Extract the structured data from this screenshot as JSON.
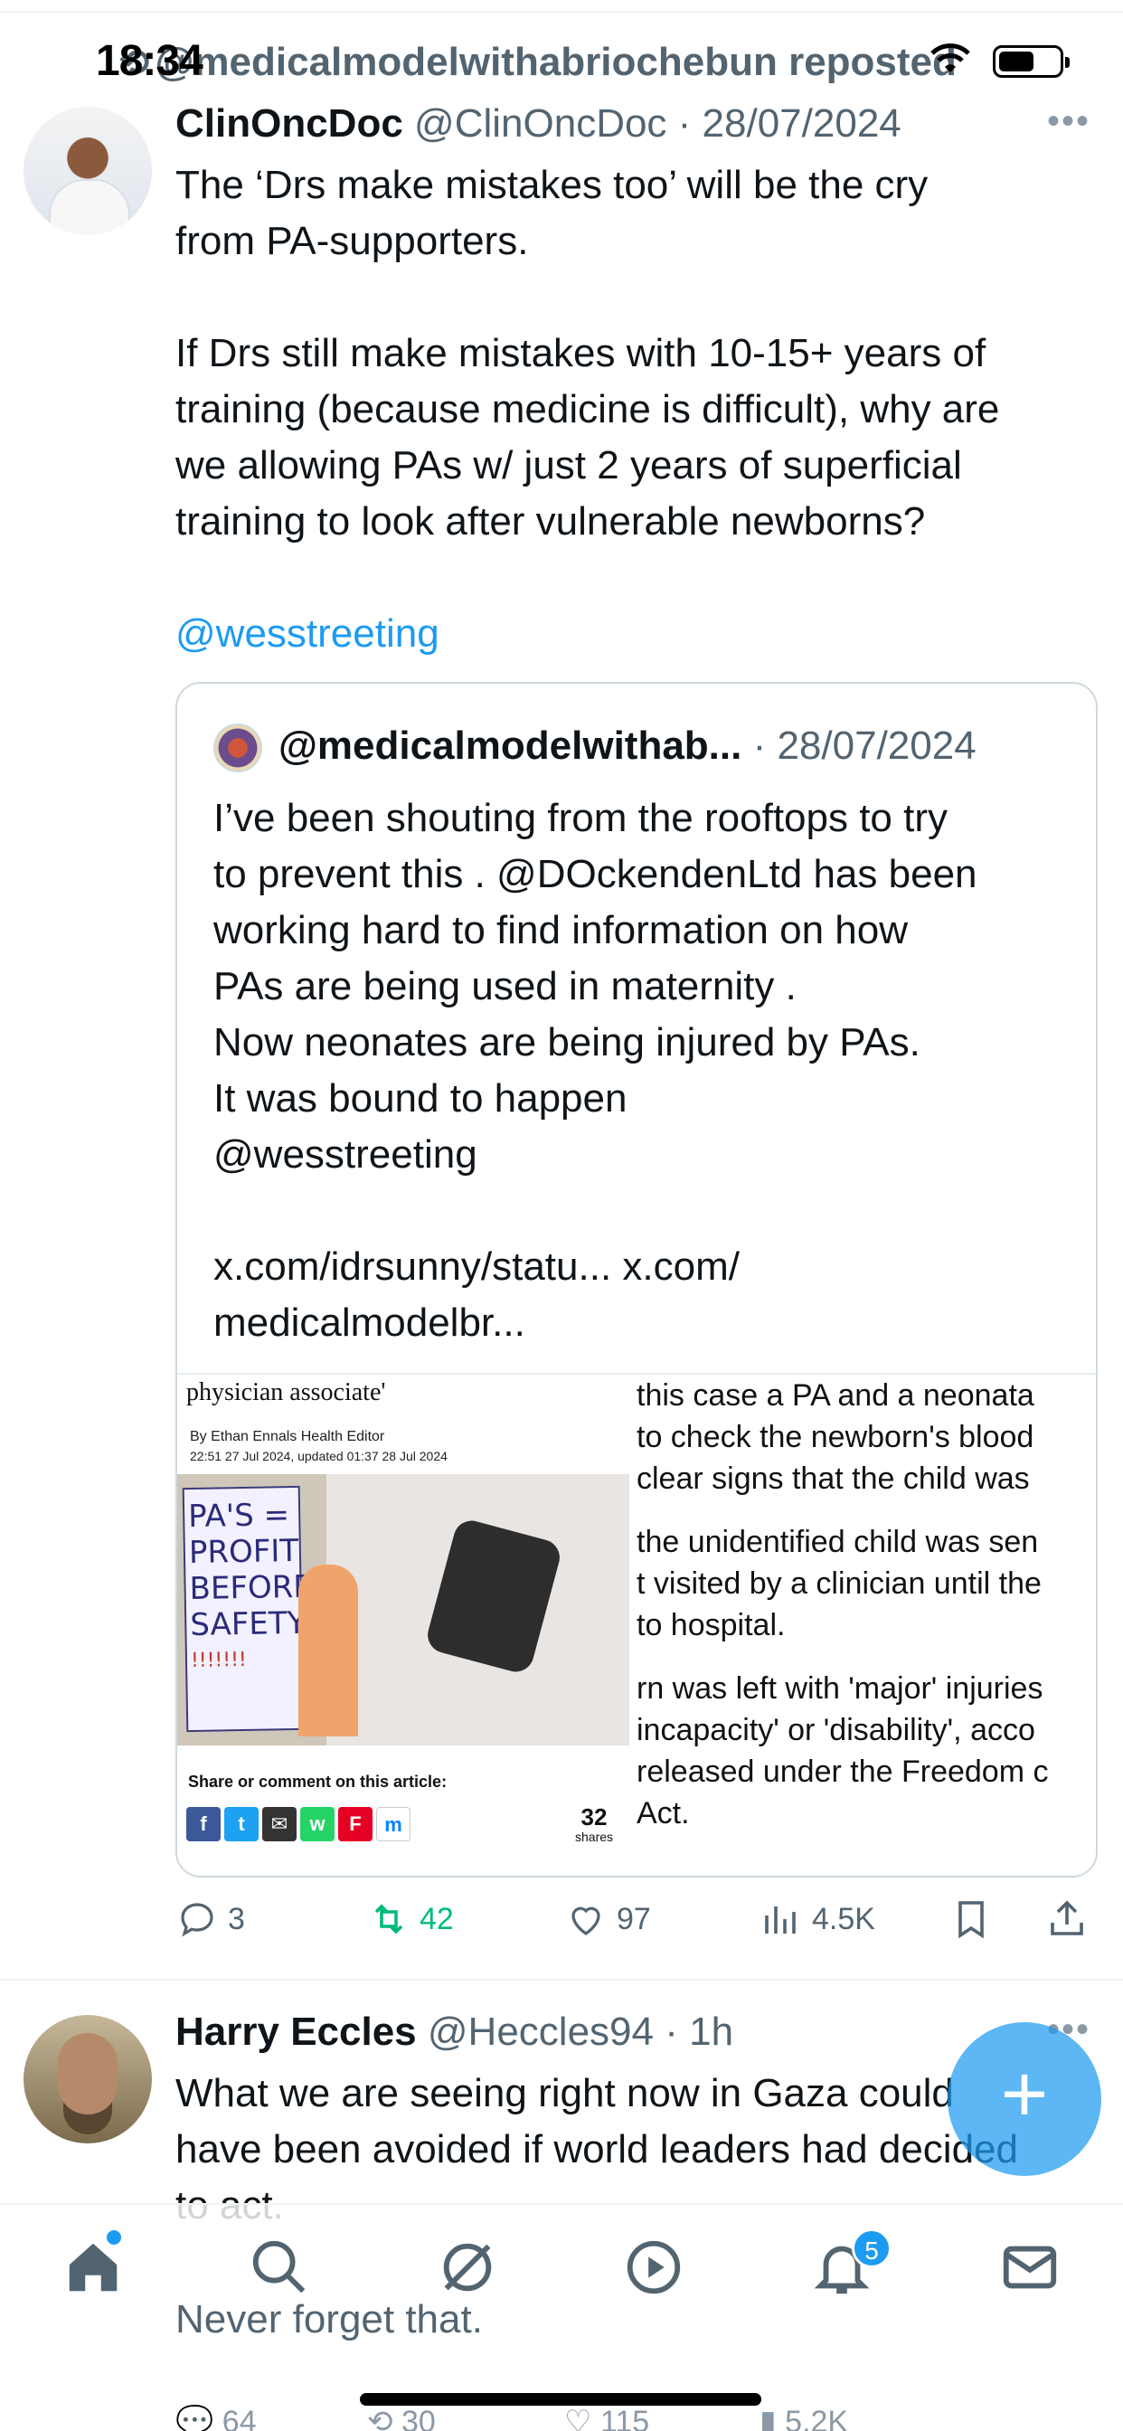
{
  "status_bar": {
    "time": "18:34",
    "repost_text": "@medicalmodelwithabriochebun reposted"
  },
  "tweet1": {
    "author_name": "ClinOncDoc",
    "handle": "@ClinOncDoc",
    "date": "· 28/07/2024",
    "lines": [
      "The ‘Drs make mistakes too’ will be the cry",
      "from PA-supporters.",
      "",
      "If Drs still make mistakes with 10-15+ years of",
      "training (because medicine is difficult), why are",
      "we allowing PAs w/ just 2 years of superficial",
      "training to look after vulnerable newborns?"
    ],
    "mention": "@wesstreeting",
    "quote": {
      "handle": "@medicalmodelwithab...",
      "date": "· 28/07/2024",
      "lines": [
        "I’ve been shouting from the rooftops to try",
        "to prevent  this . @DOckendenLtd has been",
        "working hard to find information on how",
        "PAs are being used in maternity .",
        "Now neonates  are being injured by PAs.",
        "It was bound to happen",
        "@wesstreeting",
        "",
        "x.com/idrsunny/statu... x.com/",
        "medicalmodelbr..."
      ],
      "article": {
        "headline": "physician associate'",
        "byline": "By Ethan Ennals Health Editor",
        "timestamp": "22:51 27 Jul 2024, updated 01:37 28 Jul 2024",
        "sign_text": [
          "PA'S =",
          "PROFIT",
          "BEFORE",
          "SAFETY",
          "!!!!!!!"
        ],
        "share_label": "Share or comment on this article:",
        "share_count": "32",
        "share_unit": "shares",
        "right_lines": [
          "this case a PA and a neonata",
          "to check the newborn's blood",
          "clear signs that the child was",
          "",
          "the unidentified child was sen",
          "t visited by a clinician until the",
          "to hospital.",
          "",
          "rn was left with 'major' injuries",
          "incapacity' or 'disability', acco",
          "released under the Freedom c",
          "Act."
        ]
      }
    },
    "actions": {
      "replies": "3",
      "reposts": "42",
      "likes": "97",
      "views": "4.5K"
    }
  },
  "tweet2": {
    "author_name": "Harry Eccles",
    "handle": "@Heccles94",
    "time": "· 1h",
    "lines": [
      "What we are seeing right now in Gaza could",
      "have been avoided if world leaders had decided",
      "to act."
    ],
    "faded_line": "Never forget that.",
    "actions": {
      "replies": "64",
      "reposts": "30",
      "likes": "115",
      "views": "5.2K"
    }
  },
  "fab_label": "+",
  "nav": {
    "notifications_badge": "5"
  },
  "colors": {
    "accent": "#1d9bf0",
    "retweet": "#00ba7c",
    "secondary_text": "#536471"
  }
}
